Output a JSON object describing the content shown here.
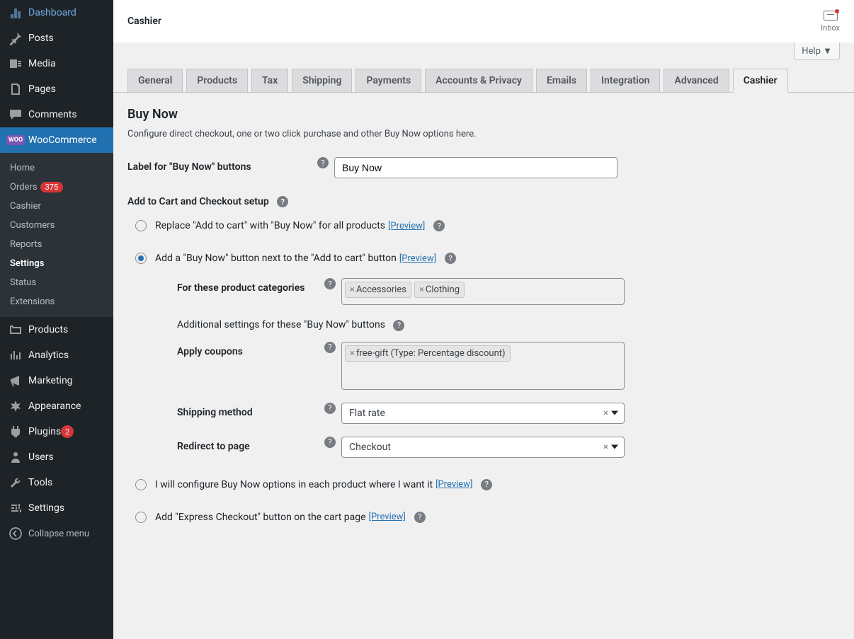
{
  "sidebar": {
    "items": [
      {
        "label": "Dashboard",
        "icon": "dashboard"
      },
      {
        "label": "Posts",
        "icon": "pin"
      },
      {
        "label": "Media",
        "icon": "media"
      },
      {
        "label": "Pages",
        "icon": "pages"
      },
      {
        "label": "Comments",
        "icon": "comments"
      },
      {
        "label": "WooCommerce",
        "icon": "woo",
        "active": true
      },
      {
        "label": "Products",
        "icon": "products"
      },
      {
        "label": "Analytics",
        "icon": "analytics"
      },
      {
        "label": "Marketing",
        "icon": "marketing"
      },
      {
        "label": "Appearance",
        "icon": "appearance"
      },
      {
        "label": "Plugins",
        "icon": "plugins",
        "badge": "2"
      },
      {
        "label": "Users",
        "icon": "users"
      },
      {
        "label": "Tools",
        "icon": "tools"
      },
      {
        "label": "Settings",
        "icon": "settings"
      }
    ],
    "sub": [
      {
        "label": "Home"
      },
      {
        "label": "Orders",
        "badge": "375"
      },
      {
        "label": "Cashier"
      },
      {
        "label": "Customers"
      },
      {
        "label": "Reports"
      },
      {
        "label": "Settings",
        "current": true
      },
      {
        "label": "Status"
      },
      {
        "label": "Extensions"
      }
    ],
    "collapse": "Collapse menu"
  },
  "header": {
    "title": "Cashier",
    "inbox": "Inbox",
    "help": "Help"
  },
  "tabs": [
    "General",
    "Products",
    "Tax",
    "Shipping",
    "Payments",
    "Accounts & Privacy",
    "Emails",
    "Integration",
    "Advanced",
    "Cashier"
  ],
  "active_tab": "Cashier",
  "section": {
    "title": "Buy Now",
    "desc": "Configure direct checkout, one or two click purchase and other Buy Now options here."
  },
  "form": {
    "label_field": {
      "label": "Label for \"Buy Now\" buttons",
      "value": "Buy Now"
    },
    "subsection": "Add to Cart and Checkout setup",
    "option1": {
      "label": "Replace \"Add to cart\" with \"Buy Now\" for all products",
      "preview": "[Preview]"
    },
    "option2": {
      "label": "Add a \"Buy Now\" button next to the \"Add to cart\" button",
      "preview": "[Preview]"
    },
    "categories": {
      "label": "For these product categories",
      "tags": [
        "Accessories",
        "Clothing"
      ]
    },
    "additional_desc": "Additional settings for these \"Buy Now\" buttons",
    "coupons": {
      "label": "Apply coupons",
      "tags": [
        "free-gift (Type: Percentage discount)"
      ]
    },
    "shipping": {
      "label": "Shipping method",
      "value": "Flat rate"
    },
    "redirect": {
      "label": "Redirect to page",
      "value": "Checkout"
    },
    "option3": {
      "label": "I will configure Buy Now options in each product where I want it",
      "preview": "[Preview]"
    },
    "option4": {
      "label": "Add \"Express Checkout\" button on the cart page",
      "preview": "[Preview]"
    }
  }
}
